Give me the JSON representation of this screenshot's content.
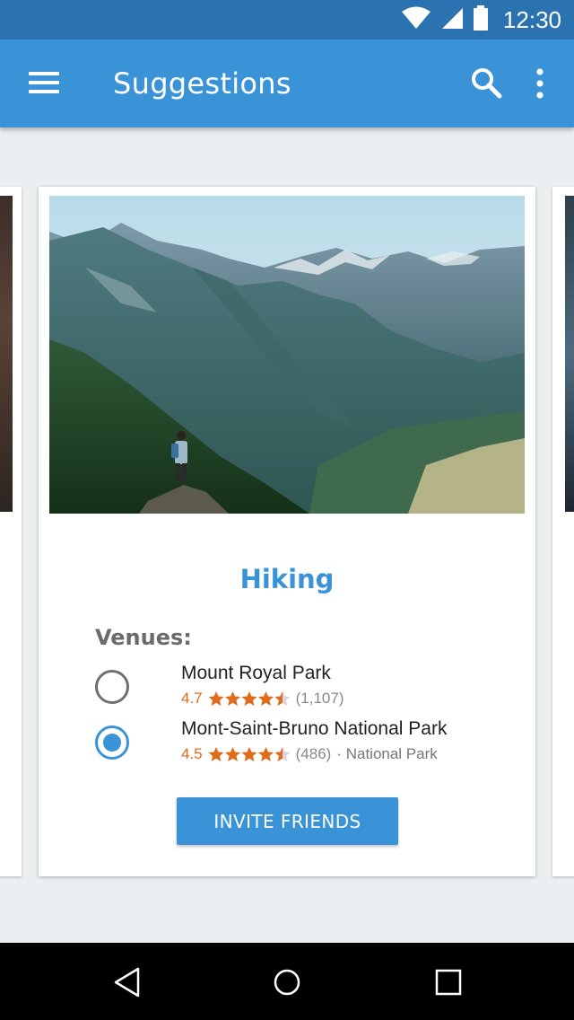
{
  "status_bar": {
    "time": "12:30",
    "icons": [
      "wifi-icon",
      "signal-icon",
      "battery-icon"
    ]
  },
  "app_bar": {
    "title": "Suggestions",
    "menu_icon": "hamburger-menu-icon",
    "search_icon": "search-icon",
    "more_icon": "more-vert-icon"
  },
  "card": {
    "activity": "Hiking",
    "venues_label": "Venues:",
    "venues": [
      {
        "name": "Mount Royal Park",
        "rating": "4.7",
        "stars": 4.5,
        "count": "(1,107)",
        "category": "",
        "selected": false
      },
      {
        "name": "Mont-Saint-Bruno National Park",
        "rating": "4.5",
        "stars": 4.5,
        "count": "(486)",
        "category": "· National Park",
        "selected": true
      }
    ],
    "invite_label": "INVITE FRIENDS"
  },
  "nav_bar": {
    "icons": [
      "back-icon",
      "home-icon",
      "recents-icon"
    ]
  },
  "colors": {
    "status_bar": "#2b73b0",
    "app_bar": "#3a93d6",
    "accent": "#3a93d6",
    "rating": "#e06b1c",
    "background": "#eceff1"
  }
}
